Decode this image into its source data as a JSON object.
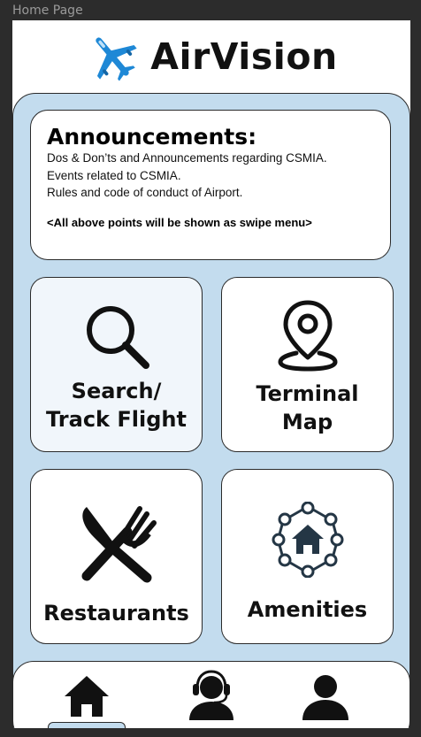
{
  "frame_label": "Home Page",
  "app": {
    "name": "AirVision",
    "logo_icon": "airplane-icon"
  },
  "announcements": {
    "title": "Announcements:",
    "lines": [
      "Dos & Don’ts and Announcements regarding CSMIA.",
      "Events related to CSMIA.",
      "Rules and code of conduct of Airport."
    ],
    "note": "<All above points will be shown as swipe menu>"
  },
  "tiles": [
    {
      "line1": "Search/",
      "line2": "Track Flight",
      "icon": "search-icon"
    },
    {
      "line1": "Terminal",
      "line2": "Map",
      "icon": "map-pin-icon"
    },
    {
      "label": "Restaurants",
      "icon": "fork-knife-icon"
    },
    {
      "label": "Amenities",
      "icon": "amenities-network-icon"
    }
  ],
  "nav": [
    {
      "icon": "home-icon",
      "active": true
    },
    {
      "icon": "customer-support-icon",
      "active": false
    },
    {
      "icon": "user-profile-icon",
      "active": false
    }
  ],
  "colors": {
    "panel": "#c3dcee",
    "plane": "#1e88d6",
    "icon": "#111111",
    "amenities_icon": "#243645"
  }
}
